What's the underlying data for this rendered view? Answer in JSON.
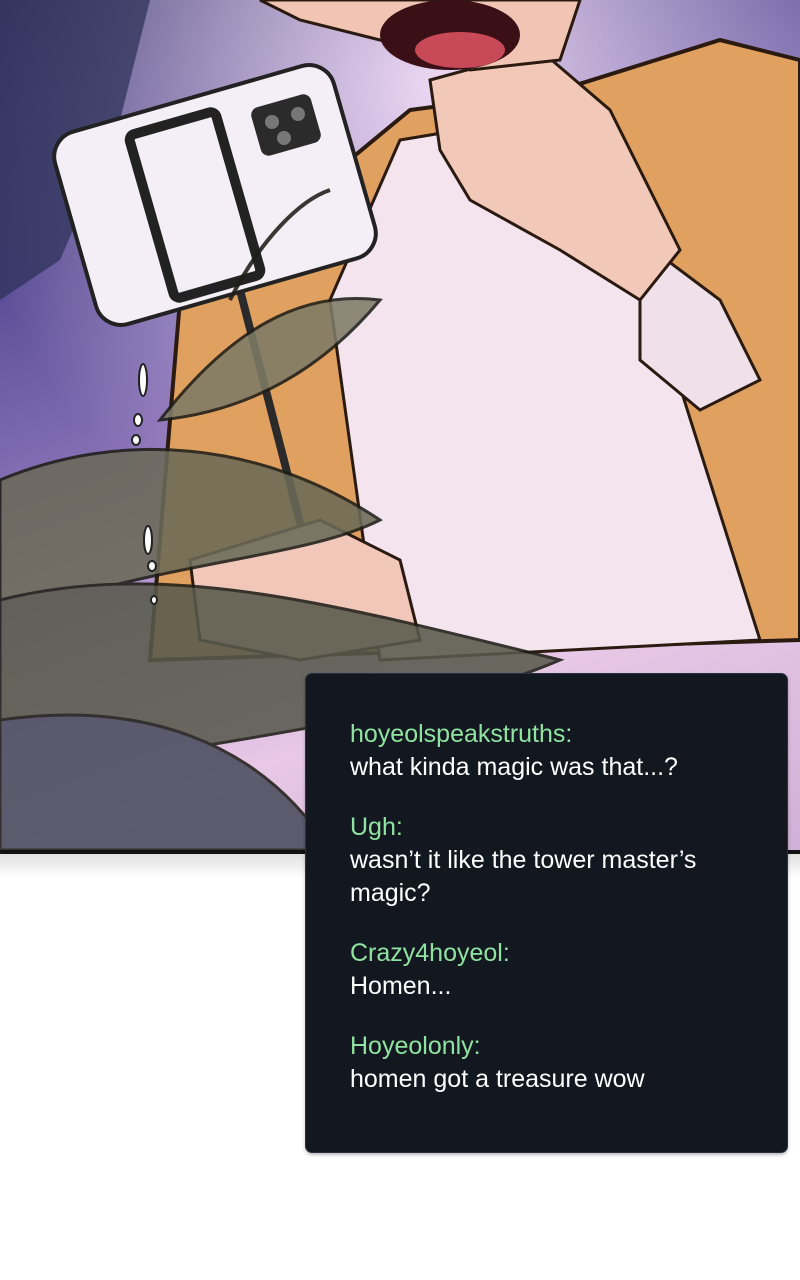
{
  "comments": [
    {
      "user": "hoyeolspeakstruths:",
      "text": "what kinda magic was that...?"
    },
    {
      "user": "Ugh:",
      "text": "wasn’t it like the tower master’s magic?"
    },
    {
      "user": "Crazy4hoyeol:",
      "text": "Homen..."
    },
    {
      "user": "Hoyeolonly:",
      "text": "homen got a treasure wow"
    }
  ],
  "colors": {
    "chat_background": "#131820",
    "username": "#8fe3a0",
    "message_text": "#ffffff"
  },
  "icons": {
    "phone": "smartphone-on-selfie-stick-icon"
  }
}
